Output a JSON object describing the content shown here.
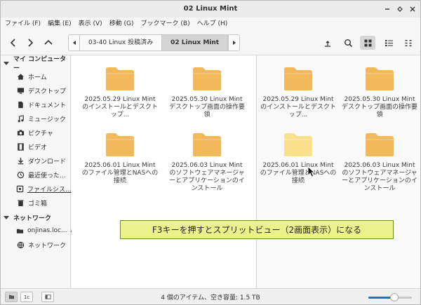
{
  "window": {
    "title": "02 Linux Mint"
  },
  "menubar": [
    "ファイル (F)",
    "編集 (E)",
    "表示 (V)",
    "移動 (G)",
    "ブックマーク (B)",
    "ヘルプ (H)"
  ],
  "pathbar": {
    "crumbs": [
      "03-40 Linux 投稿済み",
      "02 Linux Mint"
    ],
    "active_index": 1
  },
  "sidebar": {
    "sections": [
      {
        "label": "マイ コンピューター",
        "items": [
          {
            "label": "ホーム",
            "icon": "home-icon"
          },
          {
            "label": "デスクトップ",
            "icon": "desktop-icon"
          },
          {
            "label": "ドキュメント",
            "icon": "document-icon"
          },
          {
            "label": "ミュージック",
            "icon": "music-icon"
          },
          {
            "label": "ピクチャ",
            "icon": "camera-icon"
          },
          {
            "label": "ビデオ",
            "icon": "video-icon"
          },
          {
            "label": "ダウンロード",
            "icon": "download-icon"
          },
          {
            "label": "最近使った...",
            "icon": "recent-icon"
          },
          {
            "label": "ファイルシス...",
            "icon": "drive-icon"
          },
          {
            "label": "ゴミ箱",
            "icon": "trash-icon"
          }
        ]
      },
      {
        "label": "ネットワーク",
        "items": [
          {
            "label": "onjinas.loc...",
            "icon": "network-folder-icon"
          },
          {
            "label": "ネットワーク",
            "icon": "network-icon"
          }
        ]
      }
    ]
  },
  "panes": {
    "left": [
      "2025.05.29 Linux Mint のインストールとデスクトップ...",
      "2025.05.30 Linux Mint デスクトップ画面の操作要領",
      "2025.06.01 Linux Mint のファイル管理とNASへの接続",
      "2025.06.03 Linux Mint のソフトウェアマネージャーとアプリケーションのインストール"
    ],
    "right": [
      "2025.05.29 Linux Mint のインストールとデスクトップ...",
      "2025.05.30 Linux Mint デスクトップ画面の操作要領",
      "2025.06.01 Linux Mint のファイル管理とNASへの接続",
      "2025.06.03 Linux Mint のソフトウェアマネージャーとアプリケーションのインストール"
    ],
    "right_highlight_index": 2
  },
  "callout": "F3キーを押すとスプリットビュー（2画面表示）になる",
  "statusbar": {
    "text": "4 個のアイテム、空き容量: 1.5 TB",
    "zoom_level": 0.6,
    "btn_compact": "1c"
  },
  "colors": {
    "folder": "#f2b85a",
    "folder_light": "#fbe08d",
    "accent": "#1f74c8",
    "callout_bg": "#e9f38c"
  }
}
